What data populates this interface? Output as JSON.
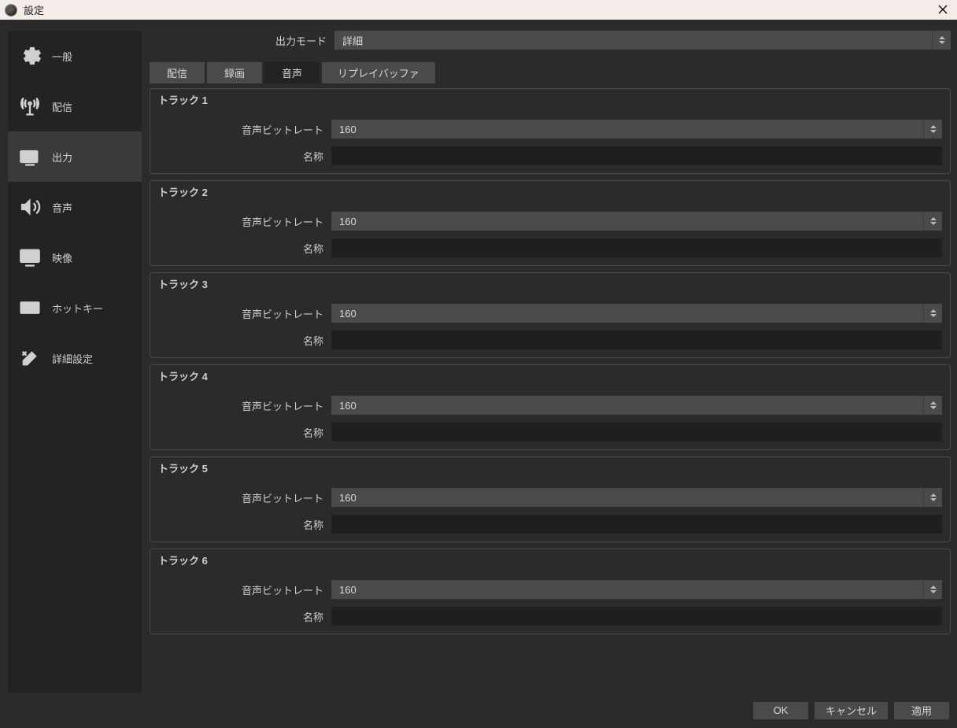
{
  "window": {
    "title": "設定"
  },
  "sidebar": {
    "items": [
      {
        "label": "一般"
      },
      {
        "label": "配信"
      },
      {
        "label": "出力"
      },
      {
        "label": "音声"
      },
      {
        "label": "映像"
      },
      {
        "label": "ホットキー"
      },
      {
        "label": "詳細設定"
      }
    ],
    "active_index": 2
  },
  "output_mode": {
    "label": "出力モード",
    "value": "詳細"
  },
  "tabs": {
    "items": [
      {
        "label": "配信"
      },
      {
        "label": "録画"
      },
      {
        "label": "音声"
      },
      {
        "label": "リプレイバッファ"
      }
    ],
    "active_index": 2
  },
  "field_labels": {
    "bitrate": "音声ビットレート",
    "name": "名称"
  },
  "tracks": [
    {
      "title": "トラック 1",
      "bitrate": "160",
      "name": ""
    },
    {
      "title": "トラック 2",
      "bitrate": "160",
      "name": ""
    },
    {
      "title": "トラック 3",
      "bitrate": "160",
      "name": ""
    },
    {
      "title": "トラック 4",
      "bitrate": "160",
      "name": ""
    },
    {
      "title": "トラック 5",
      "bitrate": "160",
      "name": ""
    },
    {
      "title": "トラック 6",
      "bitrate": "160",
      "name": ""
    }
  ],
  "footer": {
    "ok": "OK",
    "cancel": "キャンセル",
    "apply": "適用"
  }
}
